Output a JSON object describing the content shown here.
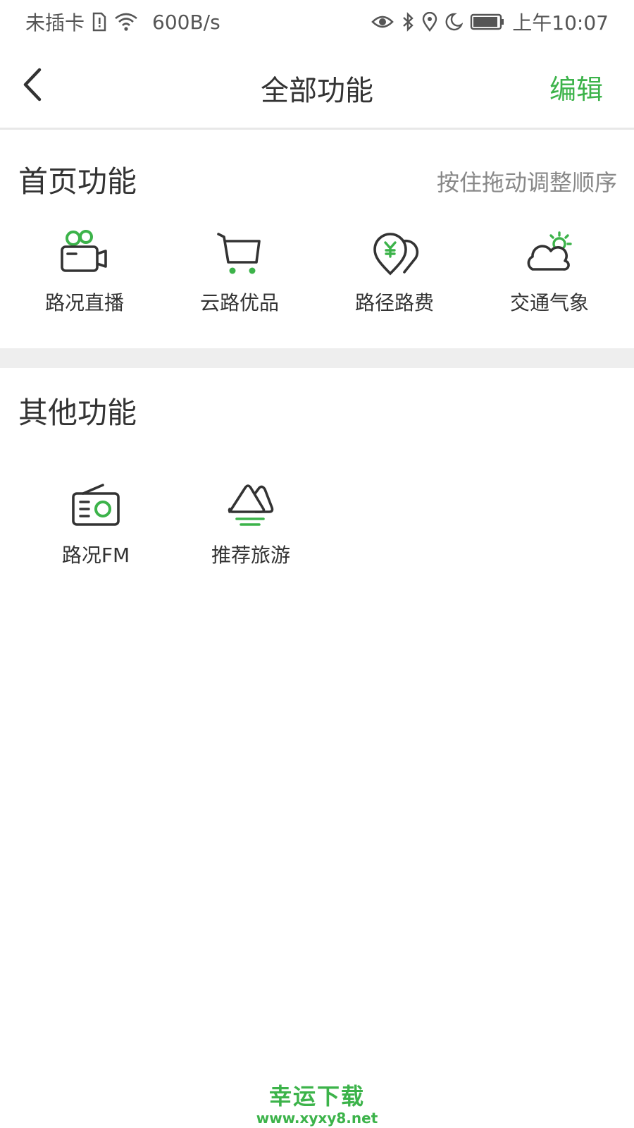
{
  "status_bar": {
    "carrier": "未插卡",
    "speed": "600B/s",
    "time": "上午10:07"
  },
  "nav": {
    "title": "全部功能",
    "edit_label": "编辑"
  },
  "home_section": {
    "title": "首页功能",
    "hint": "按住拖动调整顺序",
    "items": [
      {
        "label": "路况直播",
        "icon": "camera-icon"
      },
      {
        "label": "云路优品",
        "icon": "cart-icon"
      },
      {
        "label": "路径路费",
        "icon": "toll-pin-icon"
      },
      {
        "label": "交通气象",
        "icon": "weather-icon"
      }
    ]
  },
  "other_section": {
    "title": "其他功能",
    "items": [
      {
        "label": "路况FM",
        "icon": "radio-icon"
      },
      {
        "label": "推荐旅游",
        "icon": "mountain-icon"
      }
    ]
  },
  "watermark": {
    "name": "幸运下载",
    "url": "www.xyxy8.net"
  },
  "colors": {
    "accent": "#3cb34a",
    "text": "#333333",
    "hint": "#888888"
  }
}
